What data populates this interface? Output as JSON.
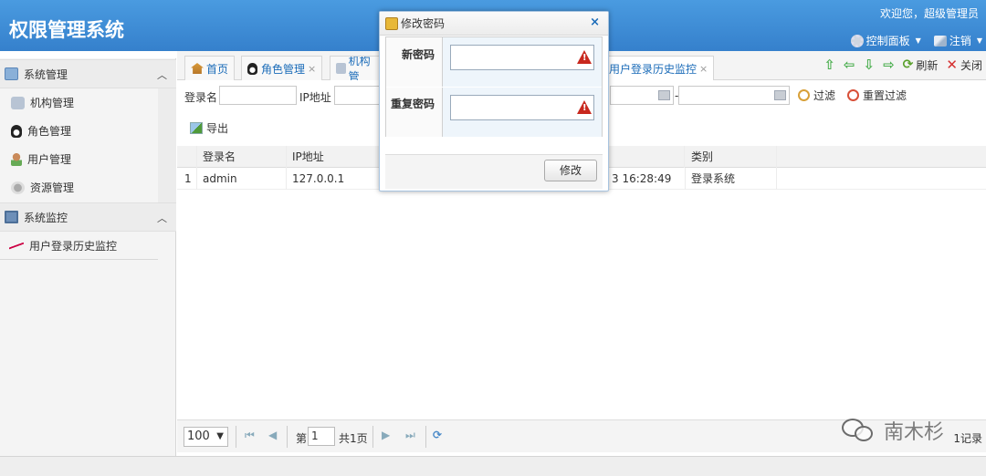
{
  "header": {
    "title": "权限管理系统",
    "welcome": "欢迎您，超级管理员",
    "control_panel": "控制面板",
    "logout": "注销"
  },
  "sidebar": {
    "groups": [
      {
        "label": "系统管理",
        "items": [
          "机构管理",
          "角色管理",
          "用户管理",
          "资源管理"
        ]
      },
      {
        "label": "系统监控",
        "items": [
          "用户登录历史监控"
        ]
      }
    ]
  },
  "tabs": [
    {
      "label": "首页"
    },
    {
      "label": "角色管理",
      "close": "×"
    },
    {
      "label": "机构管"
    },
    {
      "label": "用户登录历史监控",
      "close": "×"
    }
  ],
  "tab_tools": {
    "refresh": "刷新",
    "close": "关闭"
  },
  "filter": {
    "login_name_label": "登录名",
    "ip_label": "IP地址",
    "date_sep": "-",
    "filter_btn": "过滤",
    "reset_btn": "重置过滤"
  },
  "toolbar": {
    "export": "导出"
  },
  "grid": {
    "columns": [
      "登录名",
      "IP地址",
      "",
      "类别"
    ],
    "rows": [
      {
        "num": "1",
        "login": "admin",
        "ip": "127.0.0.1",
        "time": "3 16:28:49",
        "category": "登录系统"
      }
    ]
  },
  "pager": {
    "page_size": "100",
    "page_prefix": "第",
    "page_value": "1",
    "page_total": "共1页",
    "records": "1记录"
  },
  "dialog": {
    "title": "修改密码",
    "close": "×",
    "new_pwd_label": "新密码",
    "repeat_pwd_label": "重复密码",
    "submit": "修改"
  },
  "watermark": {
    "text": "南木杉"
  },
  "colors": {
    "header_bg": "#3d8fd8",
    "link": "#1a6bb8",
    "warn": "#c8281e"
  }
}
